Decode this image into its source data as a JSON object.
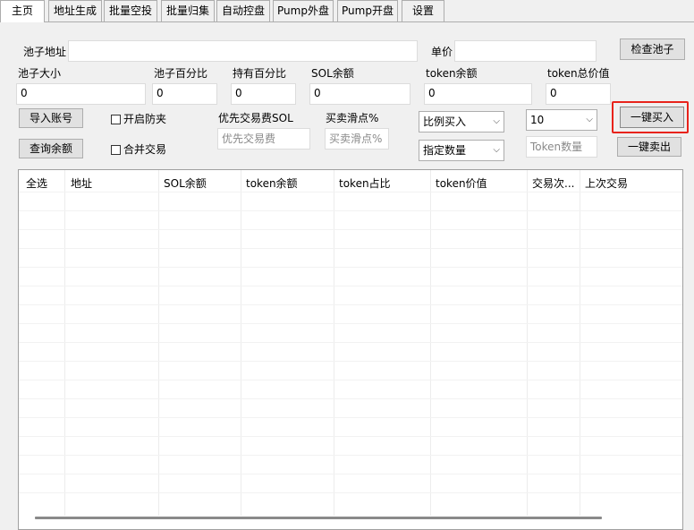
{
  "tabs": [
    "主页",
    "地址生成",
    "批量空投",
    "批量归集",
    "自动控盘",
    "Pump外盘",
    "Pump开盘",
    "设置"
  ],
  "pool": {
    "address_label": "池子地址",
    "address_value": "",
    "unit_price_label": "单价",
    "unit_price_value": "",
    "check_pool_button": "检查池子"
  },
  "stats": {
    "pool_size_label": "池子大小",
    "pool_size_value": "0",
    "pool_percent_label": "池子百分比",
    "pool_percent_value": "0",
    "hold_percent_label": "持有百分比",
    "hold_percent_value": "0",
    "sol_balance_label": "SOL余额",
    "sol_balance_value": "0",
    "token_balance_label": "token余额",
    "token_balance_value": "0",
    "token_total_label": "token总价值",
    "token_total_value": "0"
  },
  "controls": {
    "import_accounts_button": "导入账号",
    "query_balance_button": "查询余额",
    "anti_sandwich_label": "开启防夹",
    "merge_trade_label": "合并交易",
    "priority_fee_label": "优先交易费SOL",
    "priority_fee_placeholder": "优先交易费",
    "slippage_label": "买卖滑点%",
    "slippage_placeholder": "买卖滑点%",
    "buy_mode_select": "比例买入",
    "amount_mode_select": "指定数量",
    "ratio_select": "10",
    "token_amount_placeholder": "Token数量",
    "one_click_buy_button": "一键买入",
    "one_click_sell_button": "一键卖出"
  },
  "highlight_color": "#e8231b",
  "table": {
    "columns": [
      "全选",
      "地址",
      "SOL余额",
      "token余额",
      "token占比",
      "token价值",
      "交易次...",
      "上次交易"
    ],
    "rows": []
  }
}
